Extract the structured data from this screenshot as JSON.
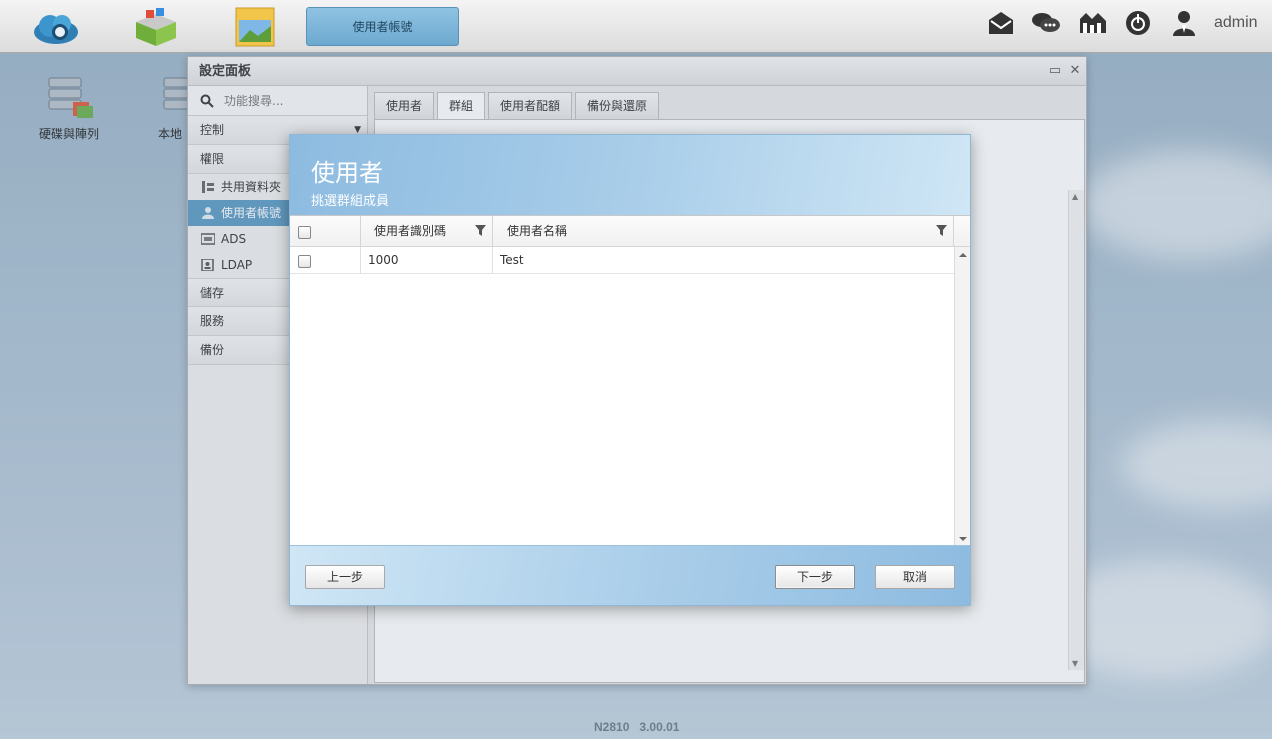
{
  "taskbar": {
    "active_app_label": "使用者帳號",
    "username": "admin",
    "apps": [
      {
        "icon": "cloud-storage-icon"
      },
      {
        "icon": "app-center-icon"
      },
      {
        "icon": "file-manager-icon"
      }
    ],
    "right_icons": [
      "mail-icon",
      "chat-icon",
      "network-icon",
      "power-icon",
      "user-icon"
    ]
  },
  "desktop": {
    "icons": [
      {
        "label": "硬碟與陣列",
        "icon": "disk-array-icon"
      },
      {
        "label": "本地",
        "icon": "local-backup-icon"
      }
    ]
  },
  "settings_panel": {
    "title": "設定面板",
    "search_placeholder": "功能搜尋...",
    "sections": {
      "control": "控制",
      "privilege": "權限",
      "storage": "儲存",
      "service": "服務",
      "backup": "備份"
    },
    "privilege_items": [
      {
        "label": "共用資料夾",
        "icon": "shared-folder-icon"
      },
      {
        "label": "使用者帳號",
        "icon": "user-account-icon"
      },
      {
        "label": "ADS",
        "icon": "ads-icon"
      },
      {
        "label": "LDAP",
        "icon": "ldap-icon"
      }
    ],
    "tabs": [
      "使用者",
      "群組",
      "使用者配額",
      "備份與還原"
    ]
  },
  "modal": {
    "title": "使用者",
    "subtitle": "挑選群組成員",
    "columns": {
      "uid": "使用者識別碼",
      "name": "使用者名稱"
    },
    "rows": [
      {
        "uid": "1000",
        "name": "Test",
        "checked": false
      }
    ],
    "buttons": {
      "back": "上一步",
      "next": "下一步",
      "cancel": "取消"
    }
  },
  "footer": {
    "model": "N2810",
    "version": "3.00.01"
  },
  "colors": {
    "accent": "#5b9ac4",
    "modal_header": "#8dbbe0"
  }
}
